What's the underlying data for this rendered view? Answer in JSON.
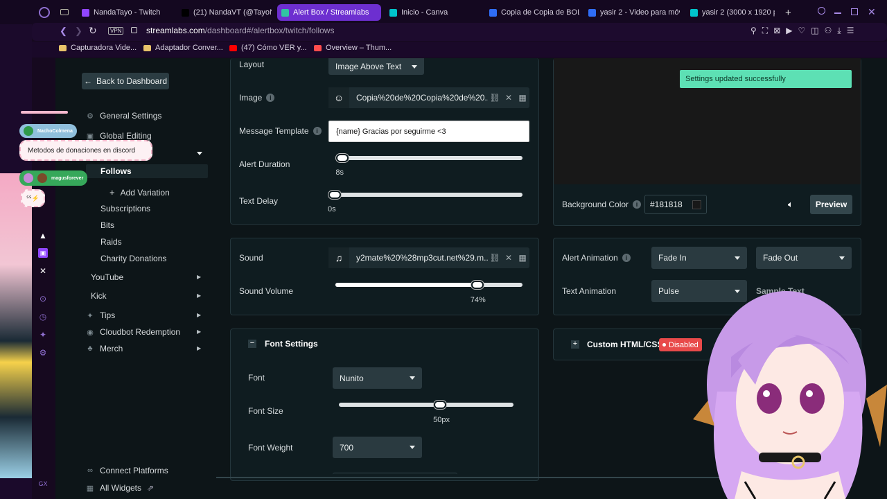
{
  "browser": {
    "tabs": [
      {
        "label": "NandaTayo - Twitch",
        "color": "#9146ff"
      },
      {
        "label": "(21) NandaVT (@TayoNa",
        "color": "#000000"
      },
      {
        "label": "Alert Box / Streamlabs",
        "color": "#31c3a2"
      },
      {
        "label": "Inicio - Canva",
        "color": "#00c4cc"
      },
      {
        "label": "Copia de Copia de BOLI",
        "color": "#2f6df6"
      },
      {
        "label": "yasir 2 - Video para móv",
        "color": "#2f6df6"
      },
      {
        "label": "yasir 2 (3000 x 1920 px)",
        "color": "#00c4cc"
      }
    ],
    "url_host": "streamlabs.com",
    "url_path": "/dashboard#/alertbox/twitch/follows",
    "vpn_label": "VPN",
    "bookmarks": [
      {
        "label": "Capturadora Vide...",
        "color": "#e8c36a"
      },
      {
        "label": "Adaptador Conver...",
        "color": "#e8c36a"
      },
      {
        "label": "(47) Cómo VER y...",
        "color": "#ff0000"
      },
      {
        "label": "Overview – Thum...",
        "color": "#ff4d4d"
      }
    ]
  },
  "sidebar": {
    "back_label": "Back to Dashboard",
    "general_settings": "General Settings",
    "global_editing": "Global Editing",
    "follows": "Follows",
    "add_variation": "Add Variation",
    "subs": "Subscriptions",
    "bits": "Bits",
    "raids": "Raids",
    "charity": "Charity Donations",
    "youtube": "YouTube",
    "kick": "Kick",
    "tips": "Tips",
    "cloudbot": "Cloudbot Redemption",
    "merch": "Merch",
    "connect": "Connect Platforms",
    "all_widgets": "All Widgets"
  },
  "overlay": {
    "chat1_user": "NachoColmena",
    "chat1_msg": "Metodos de donaciones en discord",
    "chat2_user": "magusforever",
    "chat2_msg": "ᔆᔆ⚡"
  },
  "settings": {
    "layout_label": "Layout",
    "layout_value": "Image Above Text",
    "image_label": "Image",
    "image_file": "Copia%20de%20Copia%20de%20...",
    "template_label": "Message Template",
    "template_value": "{name} Gracias por seguirme <3",
    "duration_label": "Alert Duration",
    "duration_value": "8s",
    "duration_pct": 0.02,
    "delay_label": "Text Delay",
    "delay_value": "0s",
    "delay_pct": 0.0,
    "sound_label": "Sound",
    "sound_file": "y2mate%20%28mp3cut.net%29.m...",
    "volume_label": "Sound Volume",
    "volume_value": "74%",
    "volume_pct": 0.74,
    "font_settings": "Font Settings",
    "font_label": "Font",
    "font_value": "Nunito",
    "font_size_label": "Font Size",
    "font_size_value": "50px",
    "font_size_pct": 0.56,
    "font_weight_label": "Font Weight",
    "font_weight_value": "700"
  },
  "preview": {
    "toast": "Settings updated successfully",
    "bg_label": "Background Color",
    "bg_value": "#181818",
    "preview_btn": "Preview",
    "alert_anim_label": "Alert Animation",
    "anim_in": "Fade In",
    "anim_out": "Fade Out",
    "text_anim_label": "Text Animation",
    "text_anim": "Pulse",
    "sample_text": "Sample Text",
    "custom_label": "Custom HTML/CSS",
    "custom_status": "Disabled"
  },
  "colors": {
    "accent": "#31c3a2",
    "danger": "#e84a4a",
    "toast": "#5de0b4"
  }
}
